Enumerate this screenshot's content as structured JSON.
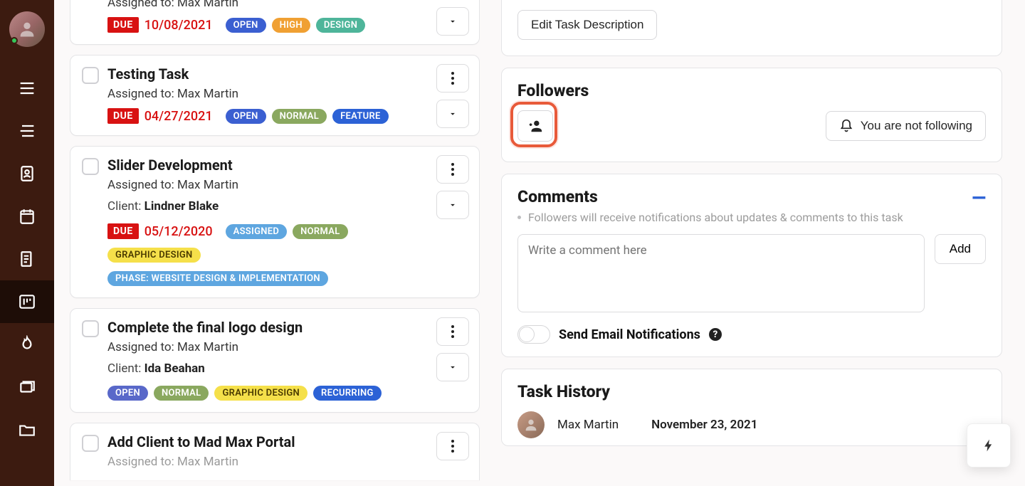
{
  "labels": {
    "assigned_prefix": "Assigned to: ",
    "client_prefix": "Client: ",
    "due": "DUE",
    "edit_task_description": "Edit Task Description",
    "followers": "Followers",
    "not_following": "You are not following",
    "comments": "Comments",
    "comments_hint": "Followers will receive notifications about updates & comments to this task",
    "comment_placeholder": "Write a comment here",
    "add": "Add",
    "send_email": "Send Email Notifications",
    "task_history": "Task History"
  },
  "tasks": [
    {
      "title": "",
      "assignee": "Max Martin",
      "due": "10/08/2021",
      "pills": [
        {
          "text": "OPEN",
          "cls": "blue"
        },
        {
          "text": "HIGH",
          "cls": "orange"
        },
        {
          "text": "DESIGN",
          "cls": "teal"
        }
      ]
    },
    {
      "title": "Testing Task",
      "assignee": "Max Martin",
      "due": "04/27/2021",
      "pills": [
        {
          "text": "OPEN",
          "cls": "blue"
        },
        {
          "text": "NORMAL",
          "cls": "olive"
        },
        {
          "text": "FEATURE",
          "cls": "royal"
        }
      ]
    },
    {
      "title": "Slider Development",
      "assignee": "Max Martin",
      "client": "Lindner Blake",
      "due": "05/12/2020",
      "pills": [
        {
          "text": "ASSIGNED",
          "cls": "skyblue"
        },
        {
          "text": "NORMAL",
          "cls": "olive"
        }
      ],
      "tags2": [
        {
          "text": "GRAPHIC DESIGN",
          "cls": "yellow"
        }
      ],
      "tags3": [
        {
          "text": "PHASE: WEBSITE DESIGN & IMPLEMENTATION",
          "cls": "skyblue"
        }
      ]
    },
    {
      "title": "Complete the final logo design",
      "assignee": "Max Martin",
      "client": "Ida Beahan",
      "pills": [
        {
          "text": "OPEN",
          "cls": "indigo"
        },
        {
          "text": "NORMAL",
          "cls": "olive"
        },
        {
          "text": "GRAPHIC DESIGN",
          "cls": "yellow"
        },
        {
          "text": "RECURRING",
          "cls": "royal"
        }
      ]
    },
    {
      "title": "Add Client to Mad Max Portal",
      "assignee": "Max Martin"
    }
  ],
  "history": {
    "name": "Max Martin",
    "date": "November 23, 2021"
  }
}
